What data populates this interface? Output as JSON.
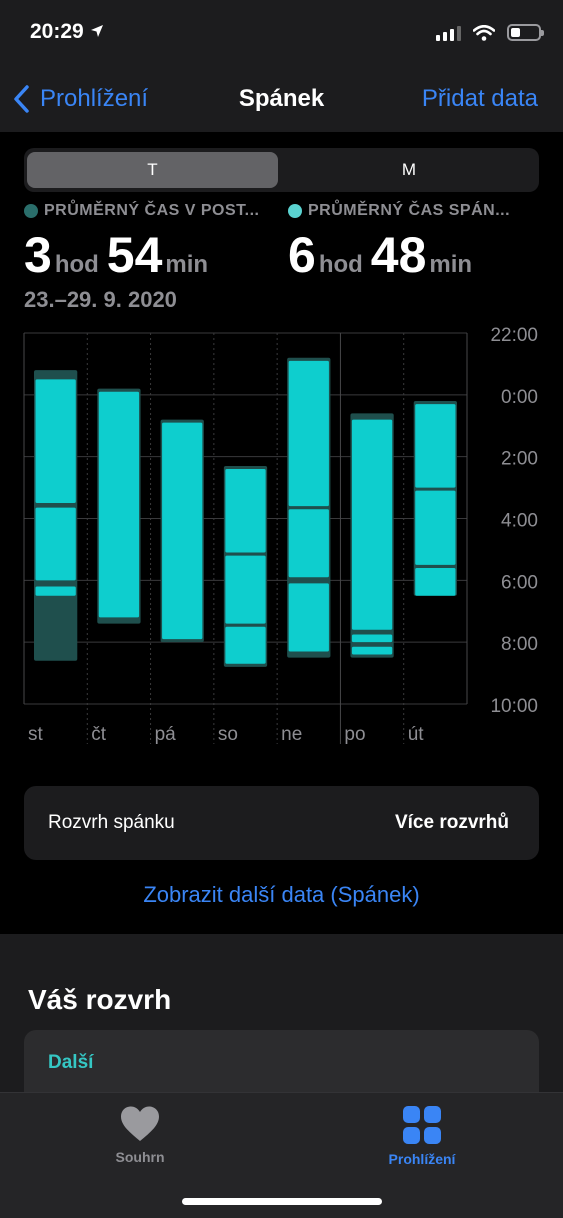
{
  "status_bar": {
    "time": "20:29",
    "battery_level": 0.35
  },
  "nav": {
    "back_label": "Prohlížení",
    "title": "Spánek",
    "action_label": "Přidat data"
  },
  "segmented": {
    "options": [
      "T",
      "M"
    ],
    "selected": "T"
  },
  "stats": [
    {
      "label": "PRŮMĚRNÝ ČAS V POST...",
      "hours": "3",
      "hours_unit": "hod",
      "minutes": "54",
      "minutes_unit": "min",
      "color": "#2a6e6b"
    },
    {
      "label": "PRŮMĚRNÝ ČAS SPÁN...",
      "hours": "6",
      "hours_unit": "hod",
      "minutes": "48",
      "minutes_unit": "min",
      "color": "#5ad2d0"
    }
  ],
  "date_range": "23.–29. 9. 2020",
  "chart_data": {
    "type": "bar",
    "categories": [
      "st",
      "čt",
      "pá",
      "so",
      "ne",
      "po",
      "út"
    ],
    "y_ticks": [
      "22:00",
      "0:00",
      "2:00",
      "4:00",
      "6:00",
      "8:00",
      "10:00"
    ],
    "y_range_hours_after_22": [
      0,
      12
    ],
    "colors": {
      "asleep": "#0ecece",
      "in_bed": "#1f4f4d"
    },
    "days": [
      {
        "day": "st",
        "in_bed": [
          1.2,
          10.6
        ],
        "asleep": [
          [
            1.5,
            5.5
          ],
          [
            5.65,
            8.0
          ],
          [
            8.2,
            8.5
          ]
        ]
      },
      {
        "day": "čt",
        "in_bed": [
          1.8,
          9.4
        ],
        "asleep": [
          [
            1.9,
            9.2
          ]
        ]
      },
      {
        "day": "pá",
        "in_bed": [
          2.8,
          10.0
        ],
        "asleep": [
          [
            2.9,
            9.9
          ]
        ]
      },
      {
        "day": "so",
        "in_bed": [
          4.3,
          10.8
        ],
        "asleep": [
          [
            4.4,
            7.1
          ],
          [
            7.2,
            9.4
          ],
          [
            9.5,
            10.7
          ]
        ]
      },
      {
        "day": "ne",
        "in_bed": [
          0.8,
          10.5
        ],
        "asleep": [
          [
            0.9,
            5.6
          ],
          [
            5.7,
            7.9
          ],
          [
            8.1,
            10.3
          ]
        ]
      },
      {
        "day": "po",
        "in_bed": [
          2.6,
          10.5
        ],
        "asleep": [
          [
            2.8,
            9.6
          ],
          [
            9.75,
            10.0
          ],
          [
            10.15,
            10.4
          ]
        ]
      },
      {
        "day": "út",
        "in_bed": [
          2.2,
          8.5
        ],
        "asleep": [
          [
            2.3,
            5.0
          ],
          [
            5.1,
            7.5
          ],
          [
            7.6,
            8.5
          ]
        ]
      }
    ]
  },
  "schedule": {
    "label": "Rozvrh spánku",
    "action": "Více rozvrhů"
  },
  "more_data_link": "Zobrazit další data (Spánek)",
  "your_schedule": {
    "title": "Váš rozvrh",
    "card_label": "Další"
  },
  "tab_bar": {
    "items": [
      {
        "label": "Souhrn",
        "icon": "heart-icon",
        "active": false
      },
      {
        "label": "Prohlížení",
        "icon": "grid-icon",
        "active": true
      }
    ]
  }
}
